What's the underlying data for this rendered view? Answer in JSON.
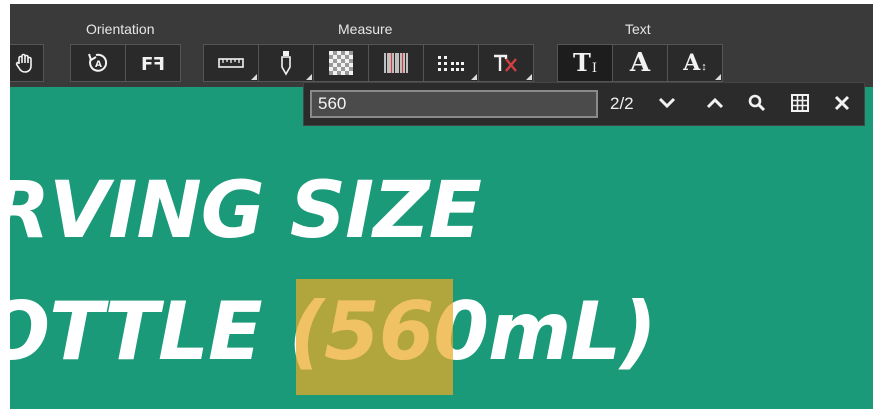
{
  "toolbar": {
    "groups": {
      "orientation": "Orientation",
      "measure": "Measure",
      "text": "Text"
    },
    "buttons": {
      "pan": "hand-icon",
      "rotate": "rotate-icon",
      "flip": "flip-text-icon",
      "ruler": "ruler-icon",
      "eyedropper": "eyedropper-icon",
      "pattern": "checkerboard-icon",
      "barcode": "barcode-icon",
      "grid": "dot-grid-icon",
      "text_compare": "text-exclude-icon",
      "text_select": "T",
      "text_font": "A",
      "text_size": "A"
    },
    "active_button": "text_select"
  },
  "find": {
    "query": "560",
    "count": "2/2"
  },
  "document": {
    "line1": "RVING SIZE",
    "line2": "OTTLE (560mL)",
    "background": "#1a9a78",
    "highlight_color": "#eca928"
  }
}
